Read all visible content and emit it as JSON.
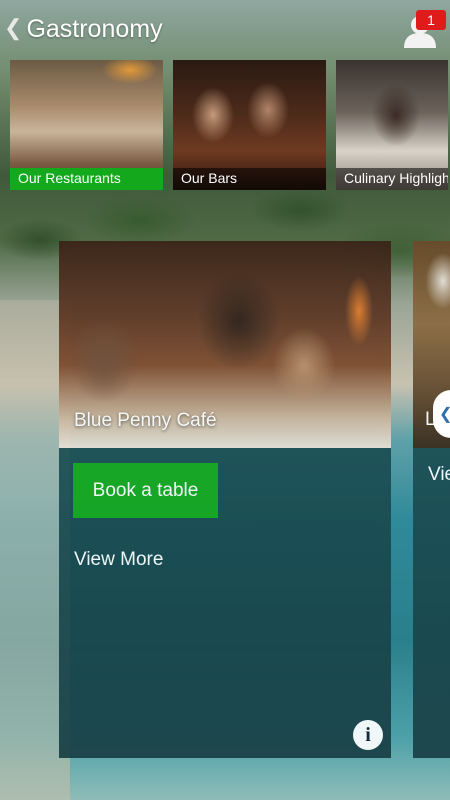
{
  "header": {
    "title": "Gastronomy",
    "notification_count": "1"
  },
  "categories": [
    {
      "label": "Our Restaurants",
      "active": true
    },
    {
      "label": "Our Bars",
      "active": false
    },
    {
      "label": "Culinary Highlights",
      "active": false
    }
  ],
  "cards": {
    "main": {
      "name": "Blue Penny Café",
      "book_label": "Book a table",
      "view_more_label": "View More",
      "info_label": "i"
    },
    "next": {
      "name": "L",
      "view_more_label": "Vie"
    }
  },
  "colors": {
    "accent_green": "#14a81c",
    "badge_red": "#e01b1b"
  },
  "icons": {
    "back": "chevron-left-icon",
    "profile": "user-icon",
    "info": "info-icon",
    "pager": "chevron-left-icon"
  }
}
